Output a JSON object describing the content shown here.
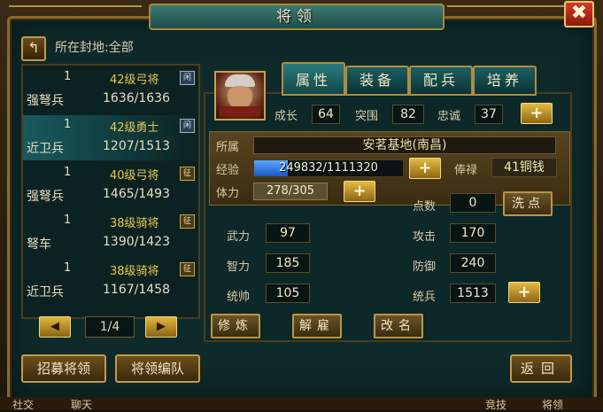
{
  "window": {
    "title": "将领",
    "close_symbol": "✖"
  },
  "location": {
    "label": "所在封地:全部",
    "back_symbol": "↰"
  },
  "generals": [
    {
      "count": "1",
      "level_class": "42级弓将",
      "tag": "闲",
      "unit": "强弩兵",
      "troops": "1636/1636",
      "selected": false
    },
    {
      "count": "1",
      "level_class": "42级勇士",
      "tag": "闲",
      "unit": "近卫兵",
      "troops": "1207/1513",
      "selected": true
    },
    {
      "count": "1",
      "level_class": "40级弓将",
      "tag": "征",
      "unit": "强弩兵",
      "troops": "1465/1493",
      "selected": false
    },
    {
      "count": "1",
      "level_class": "38级骑将",
      "tag": "征",
      "unit": "弩车",
      "troops": "1390/1423",
      "selected": false
    },
    {
      "count": "1",
      "level_class": "38级骑将",
      "tag": "征",
      "unit": "近卫兵",
      "troops": "1167/1458",
      "selected": false
    }
  ],
  "pager": {
    "text": "1/4",
    "prev": "◀",
    "next": "▶"
  },
  "tabs": [
    "属性",
    "装备",
    "配兵",
    "培养"
  ],
  "header_stats": {
    "growth_label": "成长",
    "growth": "64",
    "breakthrough_label": "突围",
    "breakthrough": "82",
    "loyalty_label": "忠诚",
    "loyalty": "37"
  },
  "info": {
    "affiliation_label": "所属",
    "affiliation": "安茗基地(南昌)",
    "exp_label": "经验",
    "exp": "249832/1111320",
    "exp_fraction": 0.225,
    "salary_label": "俸禄",
    "salary": "41铜钱",
    "stamina_label": "体力",
    "stamina": "278/305"
  },
  "attributes": {
    "points_label": "点数",
    "points": "0",
    "reset_label": "洗点",
    "force_label": "武力",
    "force": "97",
    "intel_label": "智力",
    "intel": "185",
    "command_label": "统帅",
    "command": "105",
    "attack_label": "攻击",
    "attack": "170",
    "defense_label": "防御",
    "defense": "240",
    "lead_label": "统兵",
    "lead": "1513"
  },
  "actions": {
    "train": "修炼",
    "dismiss": "解雇",
    "rename": "改名"
  },
  "bottom": {
    "recruit": "招募将领",
    "formation": "将领编队",
    "back": "返回"
  },
  "plus_symbol": "+",
  "background_strip": [
    "社交",
    "聊天",
    "竞技",
    "将领"
  ]
}
